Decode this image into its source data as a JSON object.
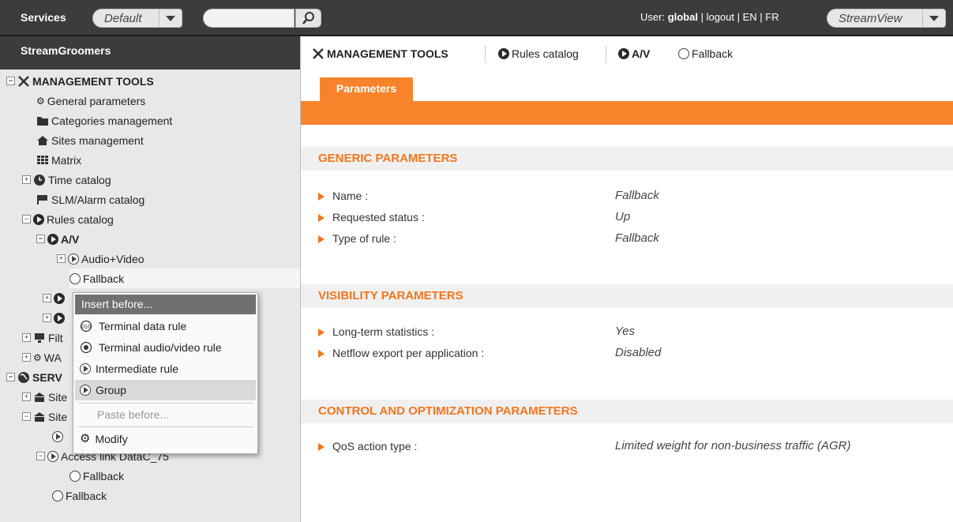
{
  "topbar": {
    "services_label": "Services",
    "profile_select": "Default",
    "search_placeholder": "",
    "user_prefix": "User:",
    "user_name": "global",
    "links": " | logout | EN | FR",
    "view_select": "StreamView"
  },
  "sidebar": {
    "title": "StreamGroomers",
    "tree": {
      "management_tools": "MANAGEMENT TOOLS",
      "general_parameters": "General parameters",
      "categories_management": "Categories management",
      "sites_management": "Sites management",
      "matrix": "Matrix",
      "time_catalog": "Time catalog",
      "slm_alarm_catalog": "SLM/Alarm catalog",
      "rules_catalog": "Rules catalog",
      "av": "A/V",
      "audio_video": "Audio+Video",
      "fallback_selected": "Fallback",
      "filt_partial": "Filt",
      "wa_partial": "WA",
      "serv_partial": "SERV",
      "site_partial_1": "Site",
      "site_partial_2": "Site",
      "access_link": "Access link DataC_75",
      "fallback_child": "Fallback",
      "fallback_last": "Fallback"
    }
  },
  "context_menu": {
    "header": "Insert before...",
    "items": [
      "Terminal data rule",
      "Terminal audio/video rule",
      "Intermediate rule",
      "Group"
    ],
    "paste": "Paste before...",
    "modify": "Modify"
  },
  "main": {
    "tabs": [
      "MANAGEMENT TOOLS",
      "Rules catalog",
      "A/V",
      "Fallback"
    ],
    "params_tab": "Parameters",
    "generic": {
      "title": "GENERIC PARAMETERS",
      "rows": [
        {
          "label": "Name :",
          "value": "Fallback"
        },
        {
          "label": "Requested status :",
          "value": "Up"
        },
        {
          "label": "Type of rule :",
          "value": "Fallback"
        }
      ]
    },
    "visibility": {
      "title": "VISIBILITY PARAMETERS",
      "rows": [
        {
          "label": "Long-term statistics :",
          "value": "Yes"
        },
        {
          "label": "Netflow export per application :",
          "value": "Disabled"
        }
      ]
    },
    "control": {
      "title": "CONTROL AND OPTIMIZATION PARAMETERS",
      "rows": [
        {
          "label": "QoS action type :",
          "value": "Limited weight for non-business traffic (AGR)"
        }
      ]
    }
  },
  "colors": {
    "accent": "#f7842a",
    "header": "#3c3c3c",
    "section_text": "#f2761d"
  }
}
